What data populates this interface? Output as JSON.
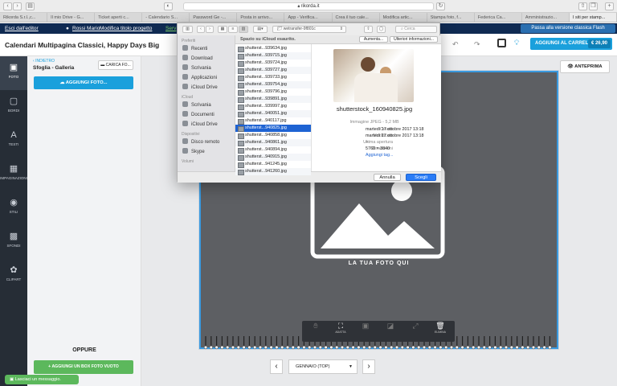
{
  "browser": {
    "url": "rikorda.it",
    "tabs": [
      "Rikorda S.r.l.,c...",
      "Il mio Drive - G...",
      "Ticket aperti c...",
      "- Calendario S...",
      "Password Ge -...",
      "Posta in arrivo...",
      "App - Verifica...",
      "Crea il tuo cale...",
      "Modifica artic...",
      "Stampa foto, f...",
      "Federica Ca...",
      "Amministrazio...",
      "I siti per stamp..."
    ]
  },
  "editor": {
    "exit": "Esci dall'editor",
    "user": "Rossi Mario",
    "rename": "Modifica titolo progetto",
    "serv": "Serv",
    "flash": "Passa alla versione classica Flash",
    "title": "Calendari Multipagina Classici, Happy Days Big",
    "cart": "AGGIUNGI AL CARRELLO",
    "price": "€ 26,90",
    "preview": "ANTEPRIMA",
    "sidebar": [
      "FOTO",
      "BORDI",
      "TESTI",
      "IMPAGINAZIONI",
      "STILI",
      "SFONDI",
      "CLIPART"
    ],
    "back": "INDIETRO",
    "gallery": "Sfoglia - Galleria",
    "load": "CARICA FO...",
    "add_photos": "AGGIUNGI FOTO...",
    "or": "OPPURE",
    "add_box": "AGGIUNGI UN BOX FOTO VUOTO",
    "chat": "Lasciaci un messaggio.",
    "placeholder": "LA TUA FOTO QUI",
    "month": "GENNAIO (TOP)",
    "tools": [
      "",
      "ADATTA",
      "",
      "",
      "",
      "ELIMINA"
    ]
  },
  "dialog": {
    "favorites_h": "Preferiti",
    "favorites": [
      "Recenti",
      "Download",
      "Scrivania",
      "Applicazioni",
      "iCloud Drive"
    ],
    "icloud_h": "iCloud",
    "icloud": [
      "Scrivania",
      "Documenti",
      "iCloud Drive"
    ],
    "devices_h": "Dispositivi",
    "devices": [
      "Disco remoto",
      "Skype"
    ],
    "more_h": "Volumi",
    "notice": "Spazio su iCloud esaurito.",
    "increase": "Aumenta...",
    "more_info": "Ulteriori informazioni...",
    "folder": "wetransfer-9f801c",
    "search": "Cerca",
    "files": [
      "shutterst...939634.jpg",
      "shutterst...939715.jpg",
      "shutterst...939724.jpg",
      "shutterst...939727.jpg",
      "shutterst...939733.jpg",
      "shutterst...939754.jpg",
      "shutterst...939796.jpg",
      "shutterst...939891.jpg",
      "shutterst...939997.jpg",
      "shutterst...940051.jpg",
      "shutterst...940117.jpg",
      "shutterst...940825.jpg",
      "shutterst...940858.jpg",
      "shutterst...940861.jpg",
      "shutterst...940894.jpg",
      "shutterst...940915.jpg",
      "shutterst...941245.jpg",
      "shutterst...941260.jpg"
    ],
    "selected_index": 11,
    "preview_name": "shutterstock_160940825.jpg",
    "kind": "Immagine JPEG - 5,2 MB",
    "meta": [
      {
        "k": "Creato",
        "v": "martedì 17 ottobre 2017 13:18"
      },
      {
        "k": "Modificato",
        "v": "martedì 17 ottobre 2017 13:18"
      },
      {
        "k": "Ultima apertura",
        "v": "--"
      },
      {
        "k": "Dimensioni",
        "v": "5760 × 3840"
      }
    ],
    "add_tag": "Aggiungi tag...",
    "cancel": "Annulla",
    "choose": "Scegli"
  },
  "colors": {
    "accent": "#1aa0dc",
    "nav": "#0f2a52",
    "green": "#5cb85c",
    "selection": "#1e63d3"
  }
}
